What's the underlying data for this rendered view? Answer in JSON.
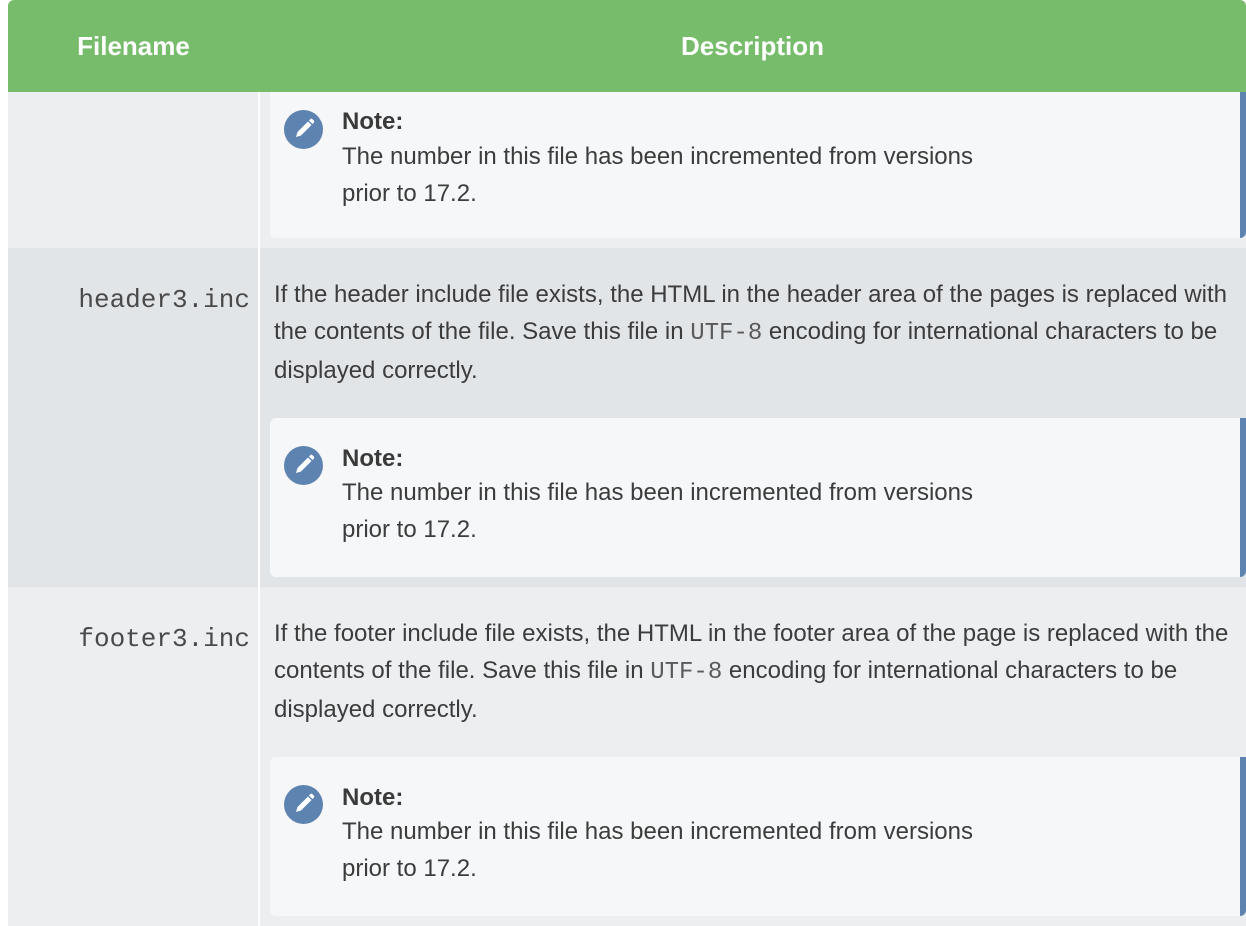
{
  "table": {
    "headers": {
      "filename": "Filename",
      "description": "Description"
    },
    "rows": [
      {
        "filename": "",
        "description_before": "",
        "description_code": "",
        "description_after": "",
        "note_title": "Note:",
        "note_text": "The number in this file has been incremented from versions prior to 17.2."
      },
      {
        "filename": "header3.inc",
        "description_before": "If the header include file exists, the HTML in the header area of the pages is replaced with the contents of the file. Save this file in ",
        "description_code": "UTF-8",
        "description_after": " encoding for international characters to be displayed correctly.",
        "note_title": "Note:",
        "note_text": "The number in this file has been incremented from versions prior to 17.2."
      },
      {
        "filename": "footer3.inc",
        "description_before": "If the footer include file exists, the HTML in the footer area of the page is replaced with the contents of the file. Save this file in ",
        "description_code": "UTF-8",
        "description_after": " encoding for international characters to be displayed correctly.",
        "note_title": "Note:",
        "note_text": "The number in this file has been incremented from versions prior to 17.2."
      }
    ]
  },
  "colors": {
    "header_bg": "#76bc6a",
    "row_light": "#eceef0",
    "row_dark": "#e2e5e8",
    "note_accent": "#5d83b1",
    "note_icon": "#5d83b1"
  },
  "icons": {
    "note": "pencil-icon"
  }
}
